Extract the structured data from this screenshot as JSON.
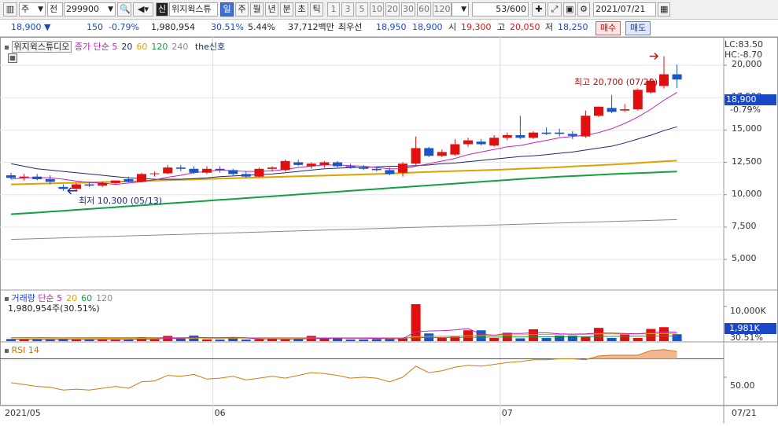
{
  "toolbar": {
    "market": "주",
    "prev": "전",
    "code": "299900",
    "name": "위지윅스튜",
    "new_flag": "신",
    "periods": [
      "일",
      "주",
      "월",
      "년",
      "분",
      "초",
      "틱"
    ],
    "selected_period": "일",
    "intervals": [
      "1",
      "3",
      "5",
      "10",
      "20",
      "30",
      "60",
      "120"
    ],
    "page_count": "53/600",
    "date": "2021/07/21"
  },
  "quote": {
    "price": "18,900",
    "dir": "▼",
    "change": "150",
    "change_pct": "-0.79%",
    "volume": "1,980,954",
    "vol_ratio": "30.51%",
    "turnover_pct": "5.44%",
    "value": "37,712백만",
    "pref_label": "최우선",
    "ask": "18,950",
    "bid": "18,900",
    "open_label": "시",
    "open": "19,300",
    "high_label": "고",
    "high": "20,050",
    "low_label": "저",
    "low": "18,250",
    "buy_label": "매수",
    "sell_label": "매도"
  },
  "price_panel": {
    "title": "위지윅스튜디오",
    "ma_label": "종가 단순",
    "ma": [
      {
        "period": "5",
        "color": "#c020c0"
      },
      {
        "period": "20",
        "color": "#1a2a6a"
      },
      {
        "period": "60",
        "color": "#e0a000"
      },
      {
        "period": "120",
        "color": "#12a040"
      },
      {
        "period": "240",
        "color": "#888888"
      }
    ],
    "signal_label": "the신호",
    "lc": "LC:83.50",
    "hc": "HC:-8.70",
    "high_note": "최고 20,700 (07/20)",
    "low_note": "최저 10,300 (05/13)",
    "last_price": "18,900",
    "last_pct": "-0.79%",
    "y_ticks": [
      "20,000",
      "17,500",
      "15,000",
      "12,500",
      "10,000",
      "7,500",
      "5,000"
    ]
  },
  "volume_panel": {
    "title": "거래량",
    "ma_label": "단순",
    "ma": [
      {
        "period": "5",
        "color": "#c020c0"
      },
      {
        "period": "20",
        "color": "#e0a000"
      },
      {
        "period": "60",
        "color": "#12a040"
      },
      {
        "period": "120",
        "color": "#888888"
      }
    ],
    "detail": "1,980,954주(30.51%)",
    "y_tick": "10,000K",
    "last_value": "1,981K",
    "last_pct": "30.51%"
  },
  "rsi_panel": {
    "title": "RSI 14",
    "y_tick": "50.00"
  },
  "x_axis": {
    "labels": [
      "2021/05",
      "06",
      "07"
    ],
    "right_label": "07/21"
  },
  "chart_data": {
    "type": "candlestick",
    "y_range": [
      2700,
      21700
    ],
    "candles": [
      {
        "o": 11500,
        "h": 11700,
        "l": 11200,
        "c": 11300
      },
      {
        "o": 11300,
        "h": 11600,
        "l": 11100,
        "c": 11400
      },
      {
        "o": 11400,
        "h": 11600,
        "l": 11100,
        "c": 11200
      },
      {
        "o": 11200,
        "h": 11500,
        "l": 10800,
        "c": 11000
      },
      {
        "o": 10600,
        "h": 10800,
        "l": 10300,
        "c": 10450
      },
      {
        "o": 10450,
        "h": 10900,
        "l": 10300,
        "c": 10800
      },
      {
        "o": 10800,
        "h": 11000,
        "l": 10600,
        "c": 10700
      },
      {
        "o": 10700,
        "h": 11000,
        "l": 10600,
        "c": 10900
      },
      {
        "o": 10900,
        "h": 11100,
        "l": 10800,
        "c": 11100
      },
      {
        "o": 11200,
        "h": 11400,
        "l": 10950,
        "c": 11000
      },
      {
        "o": 11000,
        "h": 11700,
        "l": 10950,
        "c": 11600
      },
      {
        "o": 11600,
        "h": 11800,
        "l": 11400,
        "c": 11650
      },
      {
        "o": 11650,
        "h": 12300,
        "l": 11600,
        "c": 12100
      },
      {
        "o": 12100,
        "h": 12300,
        "l": 11800,
        "c": 12000
      },
      {
        "o": 12000,
        "h": 12200,
        "l": 11600,
        "c": 11700
      },
      {
        "o": 11700,
        "h": 12200,
        "l": 11600,
        "c": 12000
      },
      {
        "o": 12000,
        "h": 12200,
        "l": 11700,
        "c": 11900
      },
      {
        "o": 11900,
        "h": 12000,
        "l": 11500,
        "c": 11600
      },
      {
        "o": 11600,
        "h": 11800,
        "l": 11300,
        "c": 11400
      },
      {
        "o": 11400,
        "h": 12100,
        "l": 11350,
        "c": 12000
      },
      {
        "o": 12000,
        "h": 12200,
        "l": 11800,
        "c": 12100
      },
      {
        "o": 11900,
        "h": 12700,
        "l": 11800,
        "c": 12600
      },
      {
        "o": 12500,
        "h": 12700,
        "l": 12200,
        "c": 12300
      },
      {
        "o": 12200,
        "h": 12500,
        "l": 12000,
        "c": 12400
      },
      {
        "o": 12300,
        "h": 12600,
        "l": 12100,
        "c": 12500
      },
      {
        "o": 12500,
        "h": 12600,
        "l": 12100,
        "c": 12200
      },
      {
        "o": 12200,
        "h": 12400,
        "l": 12000,
        "c": 12100
      },
      {
        "o": 12100,
        "h": 12300,
        "l": 11900,
        "c": 12000
      },
      {
        "o": 12000,
        "h": 12100,
        "l": 11800,
        "c": 11900
      },
      {
        "o": 11900,
        "h": 12100,
        "l": 11500,
        "c": 11600
      },
      {
        "o": 11700,
        "h": 12500,
        "l": 11400,
        "c": 12400
      },
      {
        "o": 12400,
        "h": 14500,
        "l": 12300,
        "c": 13600
      },
      {
        "o": 13600,
        "h": 13700,
        "l": 12900,
        "c": 13000
      },
      {
        "o": 13000,
        "h": 13500,
        "l": 12900,
        "c": 13300
      },
      {
        "o": 13100,
        "h": 14300,
        "l": 13000,
        "c": 13900
      },
      {
        "o": 13900,
        "h": 14400,
        "l": 13700,
        "c": 14200
      },
      {
        "o": 14100,
        "h": 14300,
        "l": 13800,
        "c": 13900
      },
      {
        "o": 13800,
        "h": 14600,
        "l": 13700,
        "c": 14400
      },
      {
        "o": 14400,
        "h": 14800,
        "l": 14200,
        "c": 14600
      },
      {
        "o": 14600,
        "h": 16100,
        "l": 14300,
        "c": 14400
      },
      {
        "o": 14400,
        "h": 14900,
        "l": 14300,
        "c": 14800
      },
      {
        "o": 14800,
        "h": 15200,
        "l": 14600,
        "c": 14700
      },
      {
        "o": 14800,
        "h": 15100,
        "l": 14500,
        "c": 14700
      },
      {
        "o": 14700,
        "h": 14900,
        "l": 14300,
        "c": 14550
      },
      {
        "o": 14500,
        "h": 16500,
        "l": 14400,
        "c": 16100
      },
      {
        "o": 16100,
        "h": 16800,
        "l": 16000,
        "c": 16800
      },
      {
        "o": 16700,
        "h": 17700,
        "l": 16300,
        "c": 16400
      },
      {
        "o": 16500,
        "h": 17000,
        "l": 16400,
        "c": 16600
      },
      {
        "o": 16600,
        "h": 18200,
        "l": 16500,
        "c": 18100
      },
      {
        "o": 17900,
        "h": 19000,
        "l": 17800,
        "c": 18800
      },
      {
        "o": 18400,
        "h": 20700,
        "l": 18200,
        "c": 19300
      },
      {
        "o": 19300,
        "h": 20050,
        "l": 18250,
        "c": 18900
      }
    ],
    "ma5": [
      11200,
      11300,
      11320,
      11300,
      11200,
      11050,
      10950,
      10900,
      10800,
      10900,
      11000,
      11150,
      11350,
      11500,
      11700,
      11800,
      11900,
      11850,
      11800,
      11800,
      11850,
      11950,
      12100,
      12200,
      12300,
      12300,
      12250,
      12200,
      12100,
      12000,
      12000,
      12200,
      12400,
      12600,
      12800,
      13100,
      13300,
      13500,
      13700,
      13800,
      14000,
      14200,
      14400,
      14500,
      14600,
      14800,
      15100,
      15500,
      16000,
      16600,
      17300,
      17900
    ],
    "ma20": [
      12400,
      12200,
      12000,
      11900,
      11800,
      11700,
      11600,
      11500,
      11400,
      11300,
      11250,
      11200,
      11200,
      11200,
      11250,
      11300,
      11400,
      11450,
      11500,
      11550,
      11600,
      11700,
      11800,
      11900,
      12000,
      12050,
      12100,
      12100,
      12150,
      12200,
      12200,
      12250,
      12300,
      12400,
      12450,
      12550,
      12650,
      12750,
      12850,
      12950,
      13000,
      13100,
      13200,
      13300,
      13450,
      13600,
      13750,
      14000,
      14300,
      14600,
      14950,
      15250
    ],
    "ma60": [
      10800,
      10820,
      10850,
      10870,
      10900,
      10920,
      10950,
      10980,
      11000,
      11030,
      11060,
      11090,
      11120,
      11150,
      11180,
      11210,
      11240,
      11270,
      11300,
      11330,
      11360,
      11390,
      11420,
      11450,
      11480,
      11510,
      11540,
      11570,
      11600,
      11640,
      11680,
      11720,
      11760,
      11800,
      11830,
      11860,
      11890,
      11920,
      11960,
      12000,
      12040,
      12080,
      12130,
      12180,
      12230,
      12280,
      12330,
      12380,
      12450,
      12520,
      12580,
      12630
    ],
    "ma120": [
      8500,
      8560,
      8620,
      8690,
      8760,
      8830,
      8900,
      8970,
      9040,
      9110,
      9180,
      9250,
      9320,
      9390,
      9460,
      9530,
      9600,
      9670,
      9740,
      9810,
      9880,
      9950,
      10020,
      10090,
      10160,
      10230,
      10300,
      10370,
      10440,
      10510,
      10580,
      10650,
      10720,
      10790,
      10860,
      10930,
      11000,
      11070,
      11140,
      11210,
      11280,
      11340,
      11390,
      11440,
      11490,
      11540,
      11590,
      11630,
      11670,
      11710,
      11750,
      11790
    ],
    "ma240": [
      6550,
      6580,
      6610,
      6640,
      6670,
      6700,
      6730,
      6760,
      6790,
      6820,
      6850,
      6880,
      6910,
      6940,
      6970,
      7000,
      7030,
      7060,
      7090,
      7120,
      7150,
      7180,
      7210,
      7240,
      7270,
      7300,
      7330,
      7360,
      7390,
      7420,
      7450,
      7480,
      7510,
      7540,
      7570,
      7600,
      7630,
      7660,
      7690,
      7720,
      7750,
      7780,
      7810,
      7840,
      7870,
      7900,
      7930,
      7960,
      7990,
      8020,
      8050,
      8080
    ],
    "volume_k": [
      600,
      500,
      500,
      450,
      650,
      450,
      450,
      450,
      400,
      500,
      1100,
      500,
      1500,
      800,
      1600,
      500,
      450,
      900,
      450,
      550,
      600,
      500,
      600,
      1500,
      700,
      900,
      450,
      500,
      600,
      600,
      800,
      10600,
      2200,
      900,
      1300,
      3100,
      3100,
      900,
      2400,
      800,
      3400,
      900,
      1600,
      1600,
      1200,
      3800,
      900,
      1900,
      900,
      3500,
      4000,
      1981
    ],
    "volume_ma5": [
      550,
      540,
      530,
      520,
      540,
      510,
      500,
      490,
      480,
      470,
      580,
      600,
      800,
      860,
      1100,
      980,
      980,
      1060,
      980,
      660,
      650,
      640,
      620,
      750,
      780,
      840,
      830,
      830,
      760,
      710,
      690,
      2700,
      2900,
      3000,
      3200,
      3600,
      2000,
      1700,
      2200,
      2200,
      2400,
      2400,
      2100,
      2000,
      2100,
      2300,
      2300,
      2200,
      2100,
      2400,
      2700,
      2500
    ],
    "volume_ma20": [
      900,
      880,
      860,
      840,
      830,
      820,
      810,
      800,
      790,
      780,
      790,
      790,
      800,
      810,
      830,
      830,
      820,
      830,
      830,
      840,
      840,
      840,
      840,
      850,
      860,
      870,
      870,
      870,
      880,
      890,
      900,
      1300,
      1370,
      1400,
      1450,
      1550,
      1650,
      1700,
      1780,
      1820,
      1900,
      1950,
      1960,
      1970,
      1990,
      2050,
      2080,
      2100,
      2100,
      2150,
      2200,
      2200
    ],
    "volume_ma60": [
      1000,
      995,
      990,
      985,
      980,
      975,
      970,
      965,
      960,
      955,
      950,
      948,
      946,
      944,
      942,
      940,
      938,
      936,
      934,
      932,
      930,
      930,
      930,
      930,
      930,
      930,
      930,
      930,
      930,
      930,
      930,
      1000,
      1020,
      1040,
      1060,
      1090,
      1120,
      1140,
      1170,
      1190,
      1220,
      1240,
      1260,
      1280,
      1300,
      1330,
      1350,
      1370,
      1390,
      1410,
      1440,
      1460
    ],
    "rsi": [
      44,
      42,
      40,
      39,
      36,
      37,
      36,
      38,
      40,
      38,
      45,
      46,
      52,
      51,
      53,
      48,
      49,
      51,
      47,
      49,
      51,
      49,
      52,
      55,
      54,
      52,
      49,
      50,
      49,
      45,
      50,
      62,
      55,
      57,
      61,
      63,
      62,
      64,
      66,
      67,
      69,
      69,
      70,
      70,
      69,
      73,
      74,
      74,
      74,
      79,
      80,
      78
    ]
  }
}
